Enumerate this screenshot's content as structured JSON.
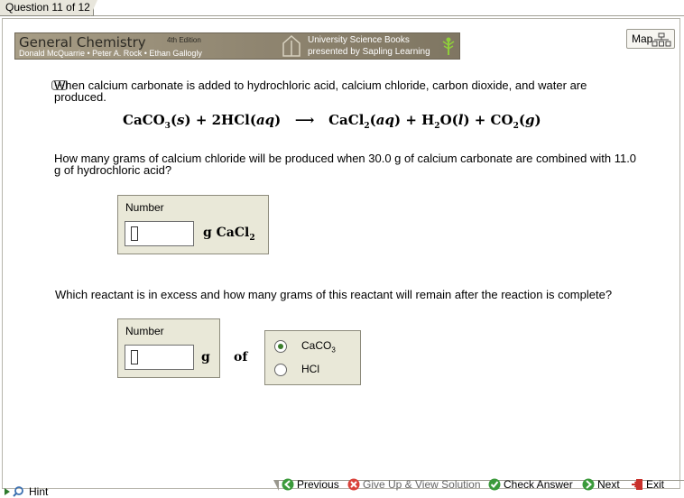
{
  "question_tab": "Question 11 of 12",
  "banner": {
    "title": "General Chemistry",
    "edition": "4th Edition",
    "authors": "Donald McQuarrie • Peter A. Rock • Ethan Gallogly",
    "publisher_line1": "University Science Books",
    "publisher_line2": "presented by Sapling Learning"
  },
  "map_label": "Map",
  "intro_text": "When calcium carbonate is added to hydrochloric acid, calcium chloride, carbon dioxide, and water are produced.",
  "question1": "How many grams of calcium chloride will be produced when 30.0 g of calcium carbonate are combined with 11.0 g of hydrochloric acid?",
  "question2": "Which reactant is in excess and how many grams of this reactant will remain after the reaction is complete?",
  "answer1": {
    "label": "Number",
    "value": "",
    "unit": "g  CaCl",
    "unit_sub": "2"
  },
  "answer2": {
    "label": "Number",
    "value": "",
    "unit": "g",
    "of": "of"
  },
  "reactants": [
    {
      "label": "CaCO",
      "sub": "3",
      "selected": true
    },
    {
      "label": "HCl",
      "sub": "",
      "selected": false
    }
  ],
  "nav": {
    "hint": "Hint",
    "previous": "Previous",
    "give_up": "Give Up & View Solution",
    "check": "Check Answer",
    "next": "Next",
    "exit": "Exit"
  }
}
